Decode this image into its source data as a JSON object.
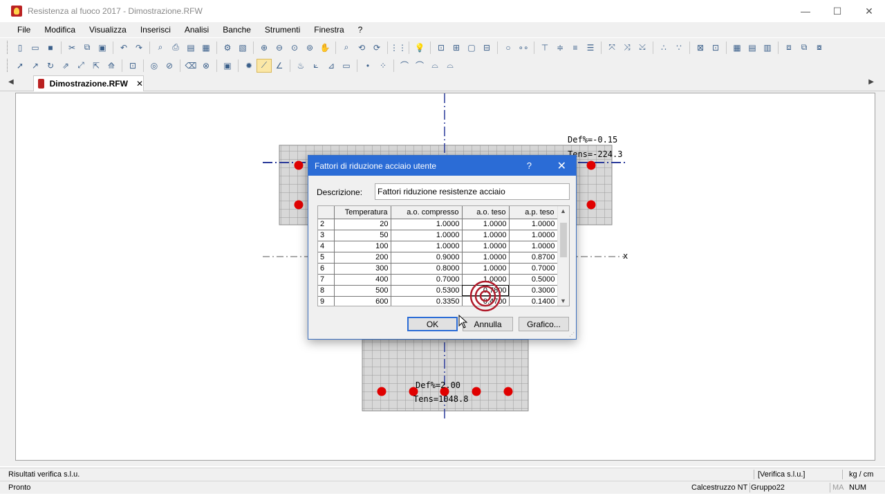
{
  "window": {
    "title": "Resistenza al fuoco 2017 - Dimostrazione.RFW",
    "minimize": "—",
    "maximize": "☐",
    "close": "✕"
  },
  "menu": [
    "File",
    "Modifica",
    "Visualizza",
    "Inserisci",
    "Analisi",
    "Banche",
    "Strumenti",
    "Finestra",
    "?"
  ],
  "tabs": {
    "document": "Dimostrazione.RFW",
    "close": "✕",
    "left_arrow": "◀",
    "right_arrow": "▶"
  },
  "canvas": {
    "top_label_def": "Def%=-0.15",
    "top_label_tens": "Tens=-224.3",
    "bottom_label_def": "Def%=2.00",
    "bottom_label_tens": "Tens=1048.8",
    "axis_x": "x"
  },
  "dialog": {
    "title": "Fattori di riduzione acciaio utente",
    "help": "?",
    "close": "✕",
    "description_label": "Descrizione:",
    "description_value": "Fattori riduzione resistenze acciaio",
    "columns": [
      "",
      "Temperatura",
      "a.o. compresso",
      "a.o. teso",
      "a.p. teso"
    ],
    "rows": [
      [
        "2",
        "20",
        "1.0000",
        "1.0000",
        "1.0000"
      ],
      [
        "3",
        "50",
        "1.0000",
        "1.0000",
        "1.0000"
      ],
      [
        "4",
        "100",
        "1.0000",
        "1.0000",
        "1.0000"
      ],
      [
        "5",
        "200",
        "0.9000",
        "1.0000",
        "0.8700"
      ],
      [
        "6",
        "300",
        "0.8000",
        "1.0000",
        "0.7000"
      ],
      [
        "7",
        "400",
        "0.7000",
        "1.0000",
        "0.5000"
      ],
      [
        "8",
        "500",
        "0.5300",
        "0.7800",
        "0.3000"
      ],
      [
        "9",
        "600",
        "0.3350",
        "0.4700",
        "0.1400"
      ]
    ],
    "buttons": {
      "ok": "OK",
      "cancel": "Annulla",
      "chart": "Grafico..."
    }
  },
  "status": {
    "line1_left": "Risultati verifica s.l.u.",
    "line1_mode": "[Verifica s.l.u.]",
    "line1_units": "kg / cm",
    "line2_left": "Pronto",
    "line2_material": "Calcestruzzo NT",
    "line2_group": "Gruppo22",
    "line2_ma": "MA",
    "line2_num": "NUM"
  }
}
